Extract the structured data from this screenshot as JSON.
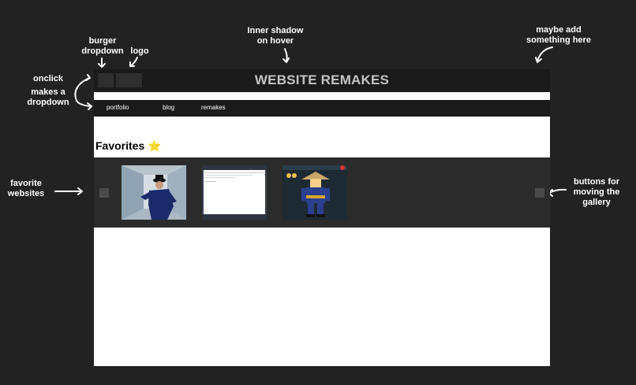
{
  "annotations": {
    "burger": "burger\ndropdown",
    "logo": "logo",
    "inner_shadow": "Inner shadow\non hover",
    "maybe_add": "maybe add\nsomething here",
    "onclick": "onclick",
    "makes_dropdown": "makes a\ndropdown",
    "favorite_websites": "favorite\nwebsites",
    "gallery_buttons": "buttons for\nmoving the\ngallery"
  },
  "header": {
    "title": "WEBSITE REMAKES"
  },
  "nav": {
    "items": [
      "portfolio",
      "blog",
      "remakes"
    ]
  },
  "favorites": {
    "title": "Favorites",
    "star": "⭐"
  },
  "gallery": {
    "thumbnails": [
      "person-in-hallway-photo",
      "web-page-screenshot",
      "game-character-screenshot"
    ]
  },
  "colors": {
    "background": "#222222",
    "header": "#1a1a1a",
    "gallery": "#2b2b2b",
    "title_text": "#c4c4c4"
  }
}
